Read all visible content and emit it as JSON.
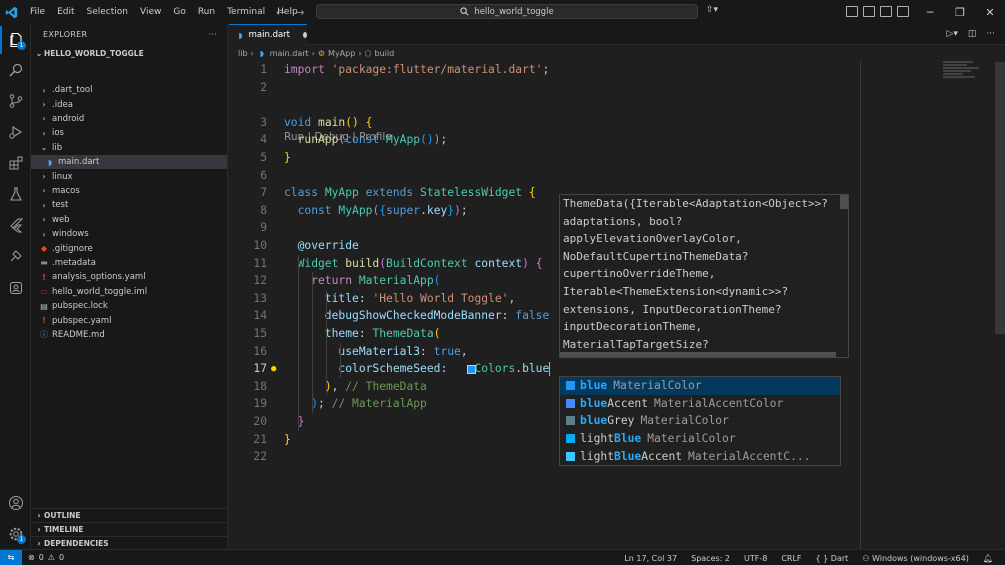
{
  "titlebar": {
    "menu": [
      "File",
      "Edit",
      "Selection",
      "View",
      "Go",
      "Run",
      "Terminal",
      "Help"
    ],
    "search_text": "hello_world_toggle"
  },
  "activity": {
    "explorer_badge": "1",
    "accounts_badge": "1"
  },
  "sidebar": {
    "header": "EXPLORER",
    "more": "···",
    "root": "HELLO_WORLD_TOGGLE",
    "tree": [
      {
        "label": ".dart_tool",
        "type": "folder",
        "depth": 1
      },
      {
        "label": ".idea",
        "type": "folder",
        "depth": 1
      },
      {
        "label": "android",
        "type": "folder",
        "depth": 1
      },
      {
        "label": "ios",
        "type": "folder",
        "depth": 1
      },
      {
        "label": "lib",
        "type": "folder-open",
        "depth": 1
      },
      {
        "label": "main.dart",
        "type": "dart",
        "depth": 2,
        "selected": true
      },
      {
        "label": "linux",
        "type": "folder",
        "depth": 1
      },
      {
        "label": "macos",
        "type": "folder",
        "depth": 1
      },
      {
        "label": "test",
        "type": "folder",
        "depth": 1
      },
      {
        "label": "web",
        "type": "folder",
        "depth": 1
      },
      {
        "label": "windows",
        "type": "folder",
        "depth": 1
      },
      {
        "label": ".gitignore",
        "type": "git",
        "depth": 1
      },
      {
        "label": ".metadata",
        "type": "meta",
        "depth": 1
      },
      {
        "label": "analysis_options.yaml",
        "type": "yaml-excl",
        "depth": 1
      },
      {
        "label": "hello_world_toggle.iml",
        "type": "iml",
        "depth": 1
      },
      {
        "label": "pubspec.lock",
        "type": "lock",
        "depth": 1
      },
      {
        "label": "pubspec.yaml",
        "type": "yaml-excl",
        "depth": 1
      },
      {
        "label": "README.md",
        "type": "info",
        "depth": 1
      }
    ],
    "sections": [
      "OUTLINE",
      "TIMELINE",
      "DEPENDENCIES"
    ]
  },
  "editor": {
    "tab": "main.dart",
    "breadcrumb": [
      "lib",
      "main.dart",
      "MyApp",
      "build"
    ],
    "codelens": "Run | Debug | Profile",
    "current_line": 17,
    "lines": [
      [
        {
          "t": "import ",
          "c": "kc"
        },
        {
          "t": "'package:flutter/material.dart'",
          "c": "str"
        },
        {
          "t": ";",
          "c": "plain"
        }
      ],
      [],
      [
        {
          "t": "void ",
          "c": "kw"
        },
        {
          "t": "main",
          "c": "fn"
        },
        {
          "t": "() ",
          "c": "br1"
        },
        {
          "t": "{",
          "c": "br1"
        }
      ],
      [
        {
          "t": "  runApp",
          "c": "fn"
        },
        {
          "t": "(",
          "c": "br2"
        },
        {
          "t": "const ",
          "c": "kw"
        },
        {
          "t": "MyApp",
          "c": "cls"
        },
        {
          "t": "()",
          "c": "br3"
        },
        {
          "t": ")",
          "c": "br2"
        },
        {
          "t": ";",
          "c": "plain"
        }
      ],
      [
        {
          "t": "}",
          "c": "br1"
        }
      ],
      [],
      [
        {
          "t": "class ",
          "c": "kw"
        },
        {
          "t": "MyApp ",
          "c": "cls"
        },
        {
          "t": "extends ",
          "c": "kw"
        },
        {
          "t": "StatelessWidget ",
          "c": "cls"
        },
        {
          "t": "{",
          "c": "br1"
        }
      ],
      [
        {
          "t": "  const ",
          "c": "kw"
        },
        {
          "t": "MyApp",
          "c": "cls"
        },
        {
          "t": "(",
          "c": "br2"
        },
        {
          "t": "{",
          "c": "br3"
        },
        {
          "t": "super",
          "c": "kw"
        },
        {
          "t": ".",
          "c": "plain"
        },
        {
          "t": "key",
          "c": "var"
        },
        {
          "t": "}",
          "c": "br3"
        },
        {
          "t": ")",
          "c": "br2"
        },
        {
          "t": ";",
          "c": "plain"
        }
      ],
      [],
      [
        {
          "t": "  @override",
          "c": "var"
        }
      ],
      [
        {
          "t": "  Widget ",
          "c": "cls"
        },
        {
          "t": "build",
          "c": "fn"
        },
        {
          "t": "(",
          "c": "br2"
        },
        {
          "t": "BuildContext ",
          "c": "cls"
        },
        {
          "t": "context",
          "c": "var"
        },
        {
          "t": ") ",
          "c": "br2"
        },
        {
          "t": "{",
          "c": "br2"
        }
      ],
      [
        {
          "t": "    return ",
          "c": "kc"
        },
        {
          "t": "MaterialApp",
          "c": "cls"
        },
        {
          "t": "(",
          "c": "br3"
        }
      ],
      [
        {
          "t": "      title",
          "c": "var"
        },
        {
          "t": ": ",
          "c": "plain"
        },
        {
          "t": "'Hello World Toggle'",
          "c": "str"
        },
        {
          "t": ",",
          "c": "plain"
        }
      ],
      [
        {
          "t": "      debugShowCheckedModeBanner",
          "c": "var"
        },
        {
          "t": ": ",
          "c": "plain"
        },
        {
          "t": "false",
          "c": "kw"
        }
      ],
      [
        {
          "t": "      theme",
          "c": "var"
        },
        {
          "t": ": ",
          "c": "plain"
        },
        {
          "t": "ThemeData",
          "c": "cls"
        },
        {
          "t": "(",
          "c": "br1"
        }
      ],
      [
        {
          "t": "        useMaterial3",
          "c": "var"
        },
        {
          "t": ": ",
          "c": "plain"
        },
        {
          "t": "true",
          "c": "kw"
        },
        {
          "t": ",",
          "c": "plain"
        }
      ],
      [
        {
          "t": "        colorSchemeSeed",
          "c": "var"
        },
        {
          "t": ": ",
          "c": "plain"
        },
        {
          "t": "   ",
          "c": "plain"
        },
        {
          "t": "Colors",
          "c": "cls"
        },
        {
          "t": ".",
          "c": "plain"
        },
        {
          "t": "blue",
          "c": "var"
        }
      ],
      [
        {
          "t": "      ",
          "c": "plain"
        },
        {
          "t": ")",
          "c": "br1"
        },
        {
          "t": ", ",
          "c": "plain"
        },
        {
          "t": "// ThemeData",
          "c": "cmt"
        }
      ],
      [
        {
          "t": "    ",
          "c": "plain"
        },
        {
          "t": ")",
          "c": "br3"
        },
        {
          "t": "; ",
          "c": "plain"
        },
        {
          "t": "// MaterialApp",
          "c": "cmt"
        }
      ],
      [
        {
          "t": "  }",
          "c": "br2"
        }
      ],
      [
        {
          "t": "}",
          "c": "br1"
        }
      ],
      []
    ]
  },
  "signature_help": [
    "ThemeData({Iterable<Adaptation<Object>>?",
    "adaptations, bool?",
    "applyElevationOverlayColor,",
    "NoDefaultCupertinoThemeData?",
    "cupertinoOverrideTheme,",
    "Iterable<ThemeExtension<dynamic>>?",
    "extensions, InputDecorationTheme?",
    "inputDecorationTheme,",
    "MaterialTapTargetSize?"
  ],
  "suggestions": [
    {
      "match": "blue",
      "rest": "",
      "detail": "MaterialColor",
      "color": "#2196f3",
      "selected": true
    },
    {
      "match": "blue",
      "rest": "Accent",
      "detail": "MaterialAccentColor",
      "color": "#448aff"
    },
    {
      "match": "blue",
      "rest": "Grey",
      "detail": "MaterialColor",
      "color": "#607d8b"
    },
    {
      "prefix": "light",
      "match": "Blue",
      "rest": "",
      "detail": "MaterialColor",
      "color": "#03a9f4"
    },
    {
      "prefix": "light",
      "match": "Blue",
      "rest": "Accent",
      "detail": "MaterialAccentC...",
      "color": "#40c4ff"
    }
  ],
  "statusbar": {
    "errors": "0",
    "warnings": "0",
    "position": "Ln 17, Col 37",
    "spaces": "Spaces: 2",
    "encoding": "UTF-8",
    "eol": "CRLF",
    "language": "Dart",
    "platform": "Windows (windows-x64)"
  }
}
